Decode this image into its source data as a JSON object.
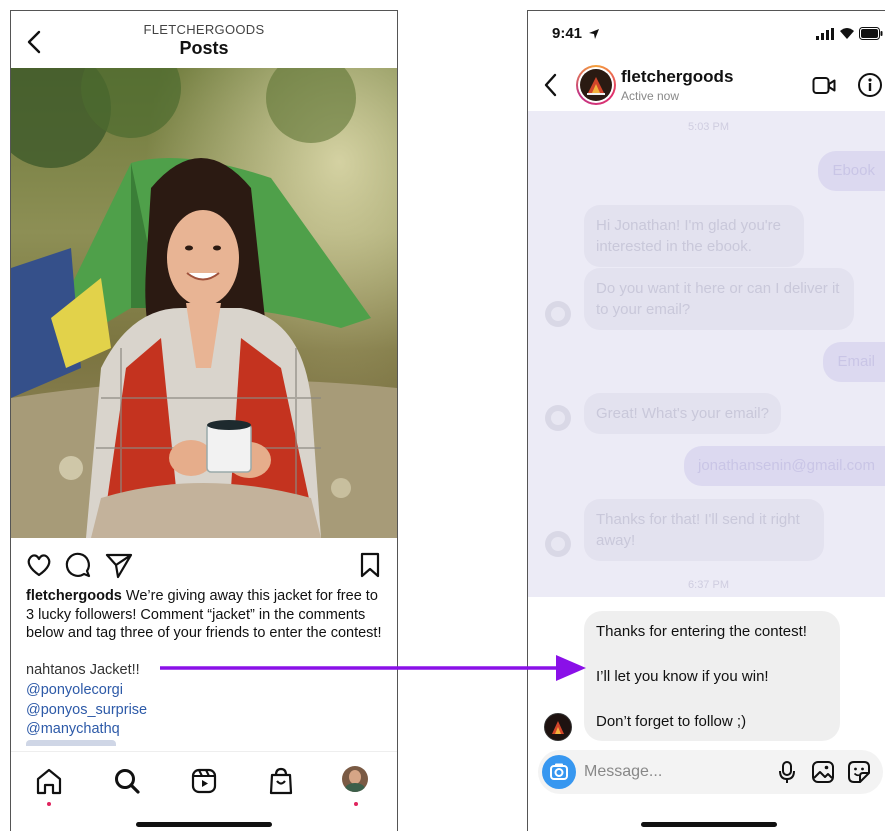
{
  "left_screen": {
    "header": {
      "account": "FLETCHERGOODS",
      "title": "Posts"
    },
    "post": {
      "photo_icon": "woman-camping-photo",
      "caption_user": "fletchergoods",
      "caption_text": " We’re giving away this jacket for free to 3 lucky followers! Comment “jacket” in the comments below and tag three of your friends to enter the contest!",
      "comment_user": "nahtanos",
      "comment_text": " Jacket!!",
      "mentions": [
        "@ponyolecorgi",
        "@ponyos_surprise",
        "@manychathq"
      ]
    },
    "actions": [
      "heart-icon",
      "comment-icon",
      "share-icon",
      "bookmark-icon"
    ],
    "tabs": [
      "home-icon",
      "search-icon",
      "reels-icon",
      "shop-icon",
      "profile-avatar"
    ]
  },
  "right_screen": {
    "status_bar": {
      "time": "9:41"
    },
    "chat_header": {
      "name": "fletchergoods",
      "status": "Active now"
    },
    "faded_history": {
      "time_top": "5:03 PM",
      "messages": [
        {
          "from": "user",
          "text": "Ebook"
        },
        {
          "from": "business",
          "text": "Hi Jonathan! I'm glad you're interested in the ebook."
        },
        {
          "from": "business",
          "text": "Do you want it here or can I deliver it to your email?"
        },
        {
          "from": "user",
          "text": "Email"
        },
        {
          "from": "business",
          "text": "Great! What's your email?"
        },
        {
          "from": "user",
          "text": "jonathansenin@gmail.com"
        },
        {
          "from": "business",
          "text": "Thanks for that! I'll send it right away!"
        }
      ],
      "time_bottom": "6:37 PM"
    },
    "active_message": {
      "line1": "Thanks for entering the contest!",
      "line2": "I’ll let you know if you win!",
      "line3": "Don’t forget to follow ;)"
    },
    "composer": {
      "placeholder": "Message..."
    }
  },
  "colors": {
    "arrow": "#8a10e8",
    "faded_background": "#ecebf6",
    "camera_button": "#3797f0",
    "mention_link": "#2d5aa8"
  }
}
